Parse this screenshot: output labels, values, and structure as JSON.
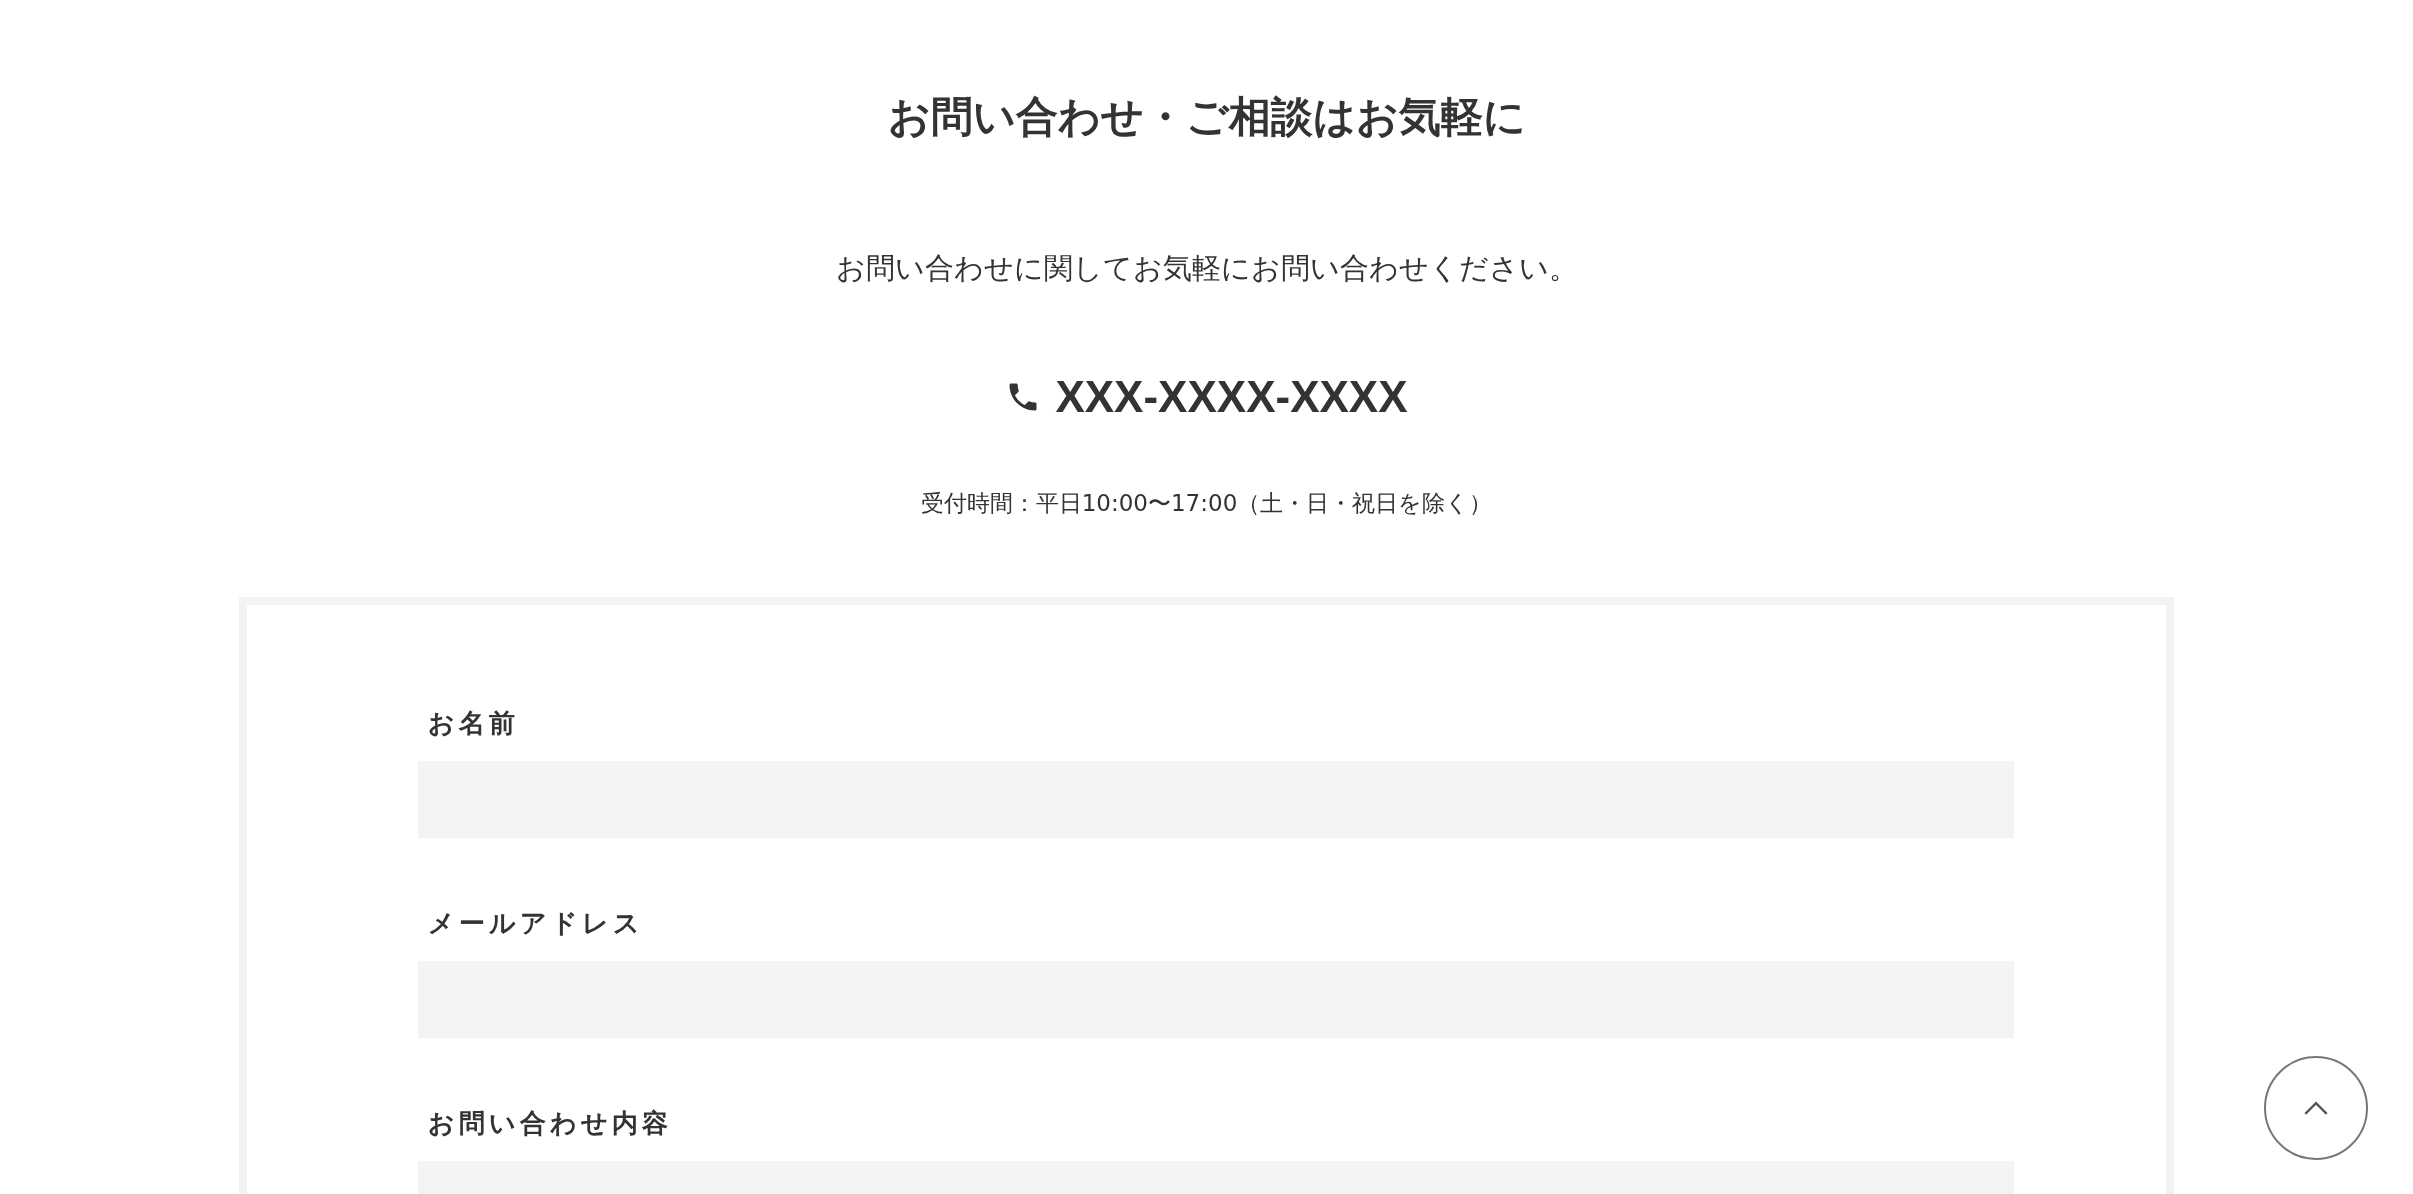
{
  "heading": "お問い合わせ・ご相談はお気軽に",
  "lead": "お問い合わせに関してお気軽にお問い合わせください。",
  "phone": {
    "number": "XXX-XXXX-XXXX"
  },
  "hours": "受付時間：平日10:00〜17:00（土・日・祝日を除く）",
  "form": {
    "fields": [
      {
        "label": "お名前",
        "kind": "text"
      },
      {
        "label": "メールアドレス",
        "kind": "text"
      },
      {
        "label": "お問い合わせ内容",
        "kind": "textarea"
      }
    ]
  }
}
